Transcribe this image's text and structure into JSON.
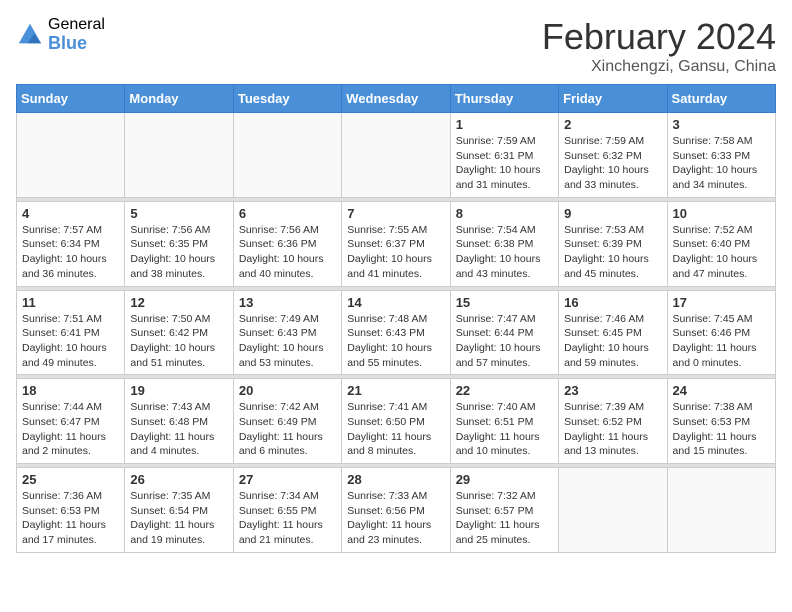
{
  "logo": {
    "general": "General",
    "blue": "Blue"
  },
  "title": {
    "month_year": "February 2024",
    "location": "Xinchengzi, Gansu, China"
  },
  "weekdays": [
    "Sunday",
    "Monday",
    "Tuesday",
    "Wednesday",
    "Thursday",
    "Friday",
    "Saturday"
  ],
  "weeks": [
    [
      {
        "day": "",
        "info": ""
      },
      {
        "day": "",
        "info": ""
      },
      {
        "day": "",
        "info": ""
      },
      {
        "day": "",
        "info": ""
      },
      {
        "day": "1",
        "info": "Sunrise: 7:59 AM\nSunset: 6:31 PM\nDaylight: 10 hours\nand 31 minutes."
      },
      {
        "day": "2",
        "info": "Sunrise: 7:59 AM\nSunset: 6:32 PM\nDaylight: 10 hours\nand 33 minutes."
      },
      {
        "day": "3",
        "info": "Sunrise: 7:58 AM\nSunset: 6:33 PM\nDaylight: 10 hours\nand 34 minutes."
      }
    ],
    [
      {
        "day": "4",
        "info": "Sunrise: 7:57 AM\nSunset: 6:34 PM\nDaylight: 10 hours\nand 36 minutes."
      },
      {
        "day": "5",
        "info": "Sunrise: 7:56 AM\nSunset: 6:35 PM\nDaylight: 10 hours\nand 38 minutes."
      },
      {
        "day": "6",
        "info": "Sunrise: 7:56 AM\nSunset: 6:36 PM\nDaylight: 10 hours\nand 40 minutes."
      },
      {
        "day": "7",
        "info": "Sunrise: 7:55 AM\nSunset: 6:37 PM\nDaylight: 10 hours\nand 41 minutes."
      },
      {
        "day": "8",
        "info": "Sunrise: 7:54 AM\nSunset: 6:38 PM\nDaylight: 10 hours\nand 43 minutes."
      },
      {
        "day": "9",
        "info": "Sunrise: 7:53 AM\nSunset: 6:39 PM\nDaylight: 10 hours\nand 45 minutes."
      },
      {
        "day": "10",
        "info": "Sunrise: 7:52 AM\nSunset: 6:40 PM\nDaylight: 10 hours\nand 47 minutes."
      }
    ],
    [
      {
        "day": "11",
        "info": "Sunrise: 7:51 AM\nSunset: 6:41 PM\nDaylight: 10 hours\nand 49 minutes."
      },
      {
        "day": "12",
        "info": "Sunrise: 7:50 AM\nSunset: 6:42 PM\nDaylight: 10 hours\nand 51 minutes."
      },
      {
        "day": "13",
        "info": "Sunrise: 7:49 AM\nSunset: 6:43 PM\nDaylight: 10 hours\nand 53 minutes."
      },
      {
        "day": "14",
        "info": "Sunrise: 7:48 AM\nSunset: 6:43 PM\nDaylight: 10 hours\nand 55 minutes."
      },
      {
        "day": "15",
        "info": "Sunrise: 7:47 AM\nSunset: 6:44 PM\nDaylight: 10 hours\nand 57 minutes."
      },
      {
        "day": "16",
        "info": "Sunrise: 7:46 AM\nSunset: 6:45 PM\nDaylight: 10 hours\nand 59 minutes."
      },
      {
        "day": "17",
        "info": "Sunrise: 7:45 AM\nSunset: 6:46 PM\nDaylight: 11 hours\nand 0 minutes."
      }
    ],
    [
      {
        "day": "18",
        "info": "Sunrise: 7:44 AM\nSunset: 6:47 PM\nDaylight: 11 hours\nand 2 minutes."
      },
      {
        "day": "19",
        "info": "Sunrise: 7:43 AM\nSunset: 6:48 PM\nDaylight: 11 hours\nand 4 minutes."
      },
      {
        "day": "20",
        "info": "Sunrise: 7:42 AM\nSunset: 6:49 PM\nDaylight: 11 hours\nand 6 minutes."
      },
      {
        "day": "21",
        "info": "Sunrise: 7:41 AM\nSunset: 6:50 PM\nDaylight: 11 hours\nand 8 minutes."
      },
      {
        "day": "22",
        "info": "Sunrise: 7:40 AM\nSunset: 6:51 PM\nDaylight: 11 hours\nand 10 minutes."
      },
      {
        "day": "23",
        "info": "Sunrise: 7:39 AM\nSunset: 6:52 PM\nDaylight: 11 hours\nand 13 minutes."
      },
      {
        "day": "24",
        "info": "Sunrise: 7:38 AM\nSunset: 6:53 PM\nDaylight: 11 hours\nand 15 minutes."
      }
    ],
    [
      {
        "day": "25",
        "info": "Sunrise: 7:36 AM\nSunset: 6:53 PM\nDaylight: 11 hours\nand 17 minutes."
      },
      {
        "day": "26",
        "info": "Sunrise: 7:35 AM\nSunset: 6:54 PM\nDaylight: 11 hours\nand 19 minutes."
      },
      {
        "day": "27",
        "info": "Sunrise: 7:34 AM\nSunset: 6:55 PM\nDaylight: 11 hours\nand 21 minutes."
      },
      {
        "day": "28",
        "info": "Sunrise: 7:33 AM\nSunset: 6:56 PM\nDaylight: 11 hours\nand 23 minutes."
      },
      {
        "day": "29",
        "info": "Sunrise: 7:32 AM\nSunset: 6:57 PM\nDaylight: 11 hours\nand 25 minutes."
      },
      {
        "day": "",
        "info": ""
      },
      {
        "day": "",
        "info": ""
      }
    ]
  ]
}
